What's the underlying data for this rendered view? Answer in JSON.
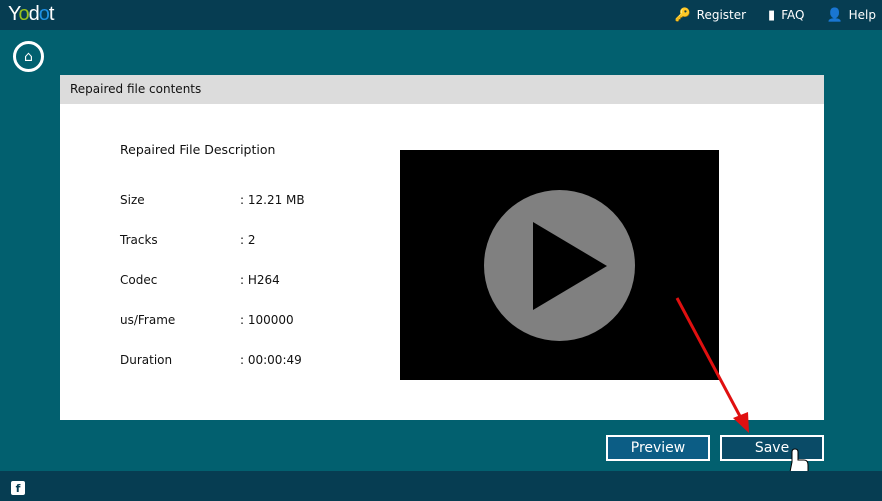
{
  "app": {
    "logo": "Yodot"
  },
  "nav": {
    "register": "Register",
    "faq": "FAQ",
    "help": "Help"
  },
  "panel": {
    "title": "Repaired file contents",
    "description": "Repaired File Description",
    "rows": [
      {
        "label": "Size",
        "value": ": 12.21 MB"
      },
      {
        "label": "Tracks",
        "value": ": 2"
      },
      {
        "label": "Codec",
        "value": ": H264"
      },
      {
        "label": "us/Frame",
        "value": ": 100000"
      },
      {
        "label": "Duration",
        "value": ": 00:00:49"
      }
    ]
  },
  "buttons": {
    "preview": "Preview",
    "save": "Save"
  }
}
